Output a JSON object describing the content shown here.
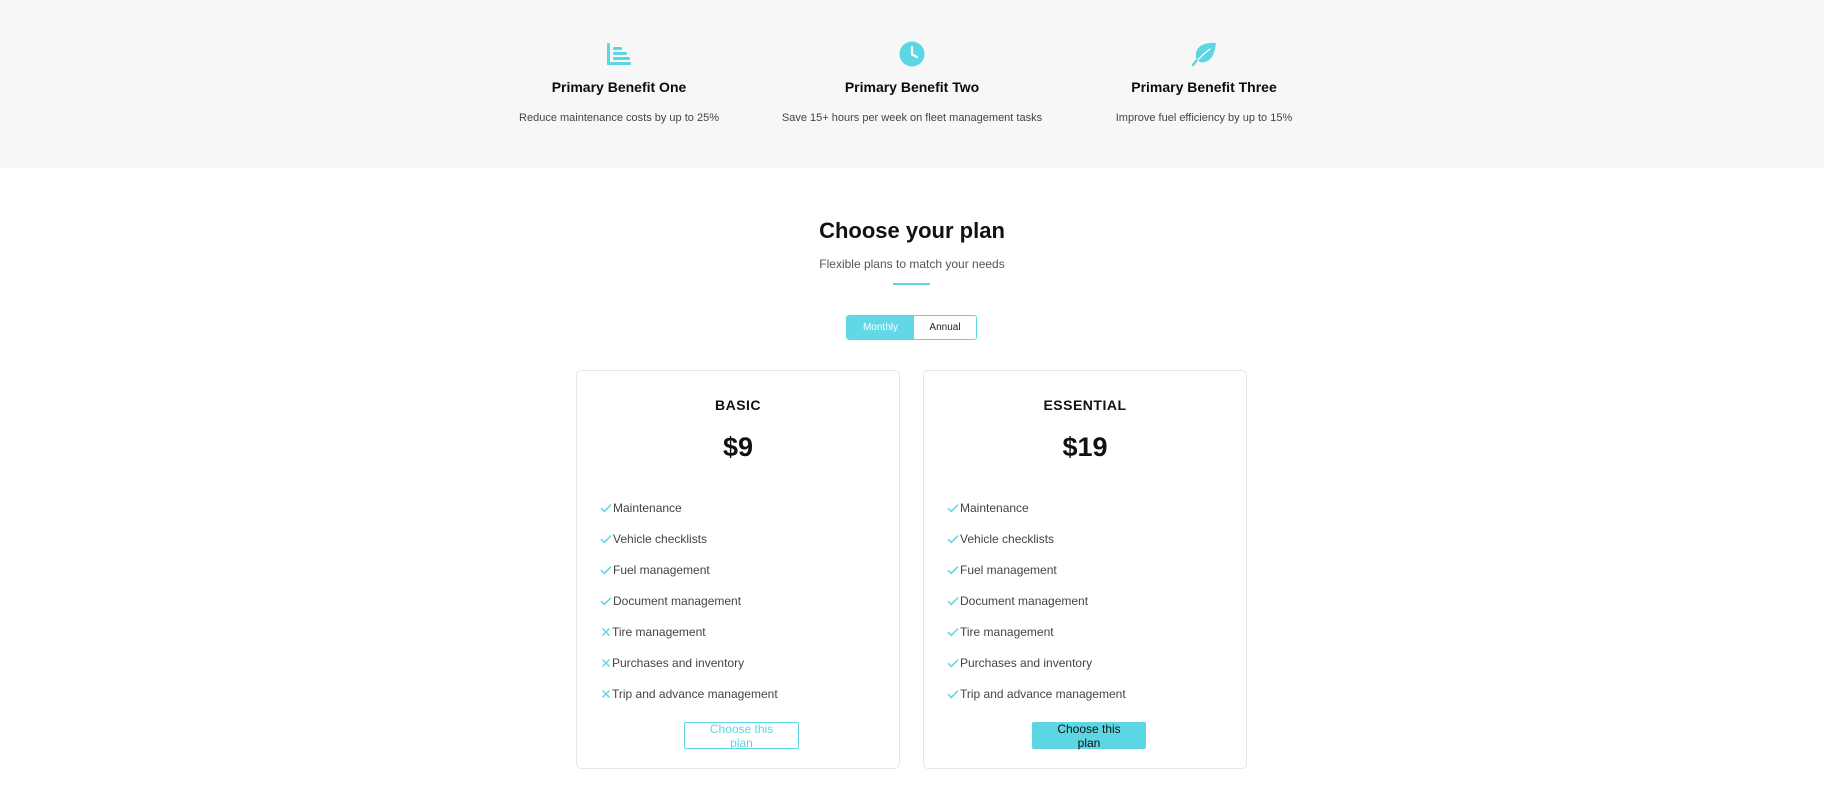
{
  "colors": {
    "accent": "#5cd6e2",
    "band_background": "#f7f7f7",
    "card_border": "#e6e6e6"
  },
  "benefits": [
    {
      "icon": "bar-chart-icon",
      "title": "Primary Benefit One",
      "description": "Reduce maintenance costs by up to 25%"
    },
    {
      "icon": "clock-icon",
      "title": "Primary Benefit Two",
      "description": "Save 15+ hours per week on fleet management tasks"
    },
    {
      "icon": "leaf-icon",
      "title": "Primary Benefit Three",
      "description": "Improve fuel efficiency by up to 15%"
    }
  ],
  "plans_section": {
    "title": "Choose your plan",
    "subtitle": "Flexible plans to match your needs"
  },
  "billing_toggle": {
    "options": [
      "Monthly",
      "Annual"
    ],
    "selected": "Monthly"
  },
  "plans": [
    {
      "name": "BASIC",
      "price": "$9",
      "features": [
        {
          "label": "Maintenance",
          "included": true
        },
        {
          "label": "Vehicle checklists",
          "included": true
        },
        {
          "label": "Fuel management",
          "included": true
        },
        {
          "label": "Document management",
          "included": true
        },
        {
          "label": "Tire management",
          "included": false
        },
        {
          "label": "Purchases and inventory",
          "included": false
        },
        {
          "label": "Trip and advance management",
          "included": false
        }
      ],
      "button_label": "Choose this plan"
    },
    {
      "name": "ESSENTIAL",
      "price": "$19",
      "features": [
        {
          "label": "Maintenance",
          "included": true
        },
        {
          "label": "Vehicle checklists",
          "included": true
        },
        {
          "label": "Fuel management",
          "included": true
        },
        {
          "label": "Document management",
          "included": true
        },
        {
          "label": "Tire management",
          "included": true
        },
        {
          "label": "Purchases and inventory",
          "included": true
        },
        {
          "label": "Trip and advance management",
          "included": true
        }
      ],
      "button_label": "Choose this plan"
    }
  ]
}
